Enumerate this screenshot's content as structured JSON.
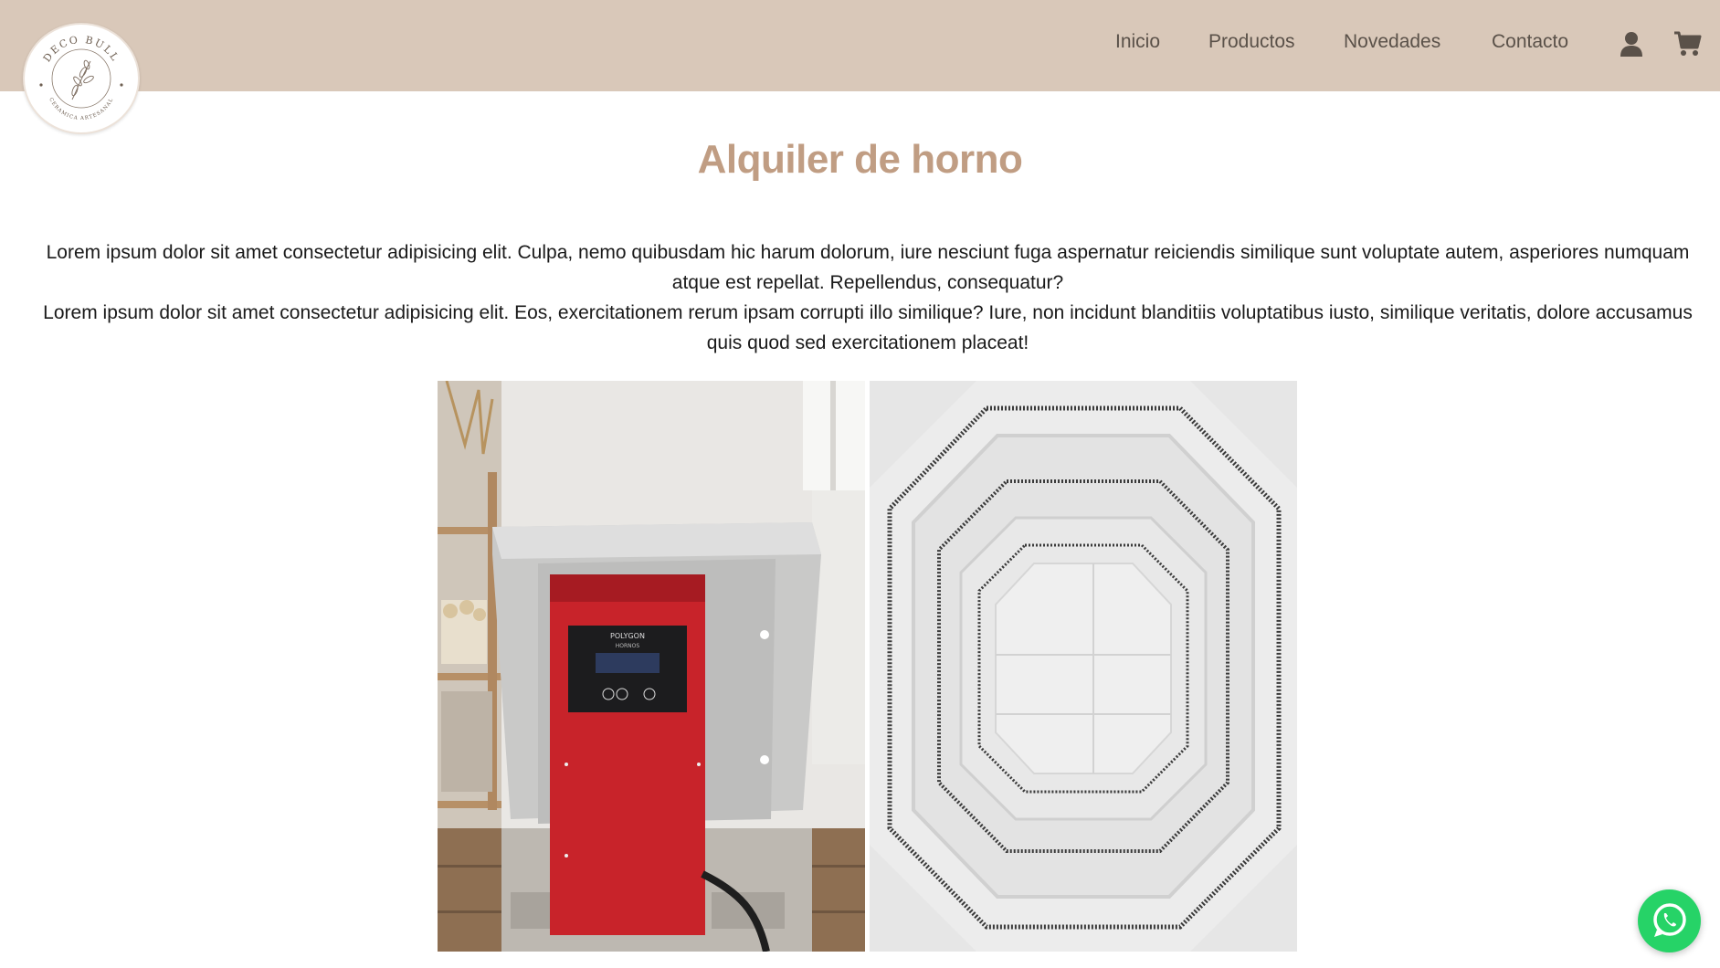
{
  "brand": {
    "logo_text_top": "DECO BULL",
    "logo_text_bottom": "CERAMICA ARTESANAL"
  },
  "nav": {
    "items": [
      "Inicio",
      "Productos",
      "Novedades",
      "Contacto"
    ],
    "account_icon": "user-icon",
    "cart_icon": "cart-icon"
  },
  "page": {
    "title": "Alquiler de horno",
    "paragraph1": "Lorem ipsum dolor sit amet consectetur adipisicing elit. Culpa, nemo quibusdam hic harum dolorum, iure nesciunt fuga aspernatur reiciendis similique sunt voluptate autem, asperiores numquam atque est repellat. Repellendus, consequatur?",
    "paragraph2": "Lorem ipsum dolor sit amet consectetur adipisicing elit. Eos, exercitationem rerum ipsam corrupti illo similique? Iure, non incidunt blanditiis voluptatibus iusto, similique veritatis, dolore accusamus quis quod sed exercitationem placeat!"
  },
  "photos": {
    "kiln_panel_brand": "POLYGON",
    "kiln_panel_sub": "HORNOS"
  },
  "whatsapp": {
    "icon": "whatsapp-icon"
  },
  "colors": {
    "header_bg": "#d9c8b9",
    "title": "#c09d83",
    "nav_text": "#5a5149",
    "whatsapp": "#26d367",
    "kiln_red": "#c8232a"
  }
}
